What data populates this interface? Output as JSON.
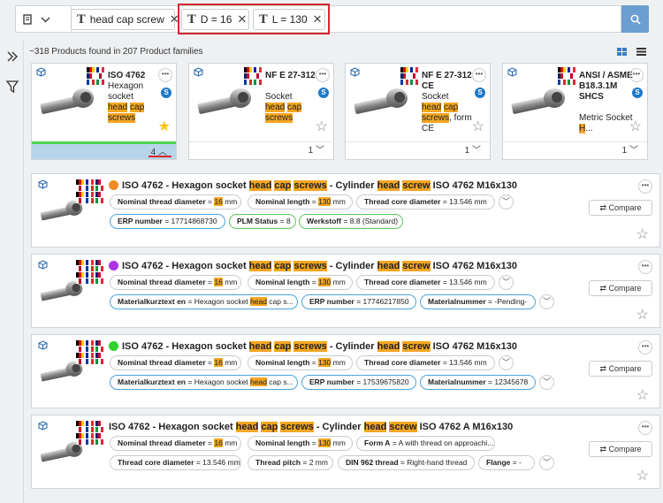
{
  "search": {
    "chips": [
      {
        "label": "head cap screw"
      },
      {
        "label": "D = 16"
      },
      {
        "label": "L = 130"
      }
    ]
  },
  "result_count": "~318 Products found in 207 Product families",
  "cards": [
    {
      "title": "ISO 4762",
      "desc_pre": "Hexagon socket",
      "hl1": "head",
      "hl2": "cap",
      "hl3": "screws",
      "desc_post": "",
      "count": "4",
      "selected": true
    },
    {
      "title": "NF E 27-312",
      "desc_pre": "Socket",
      "hl1": "head",
      "hl2": "cap",
      "hl3": "screws",
      "desc_post": "",
      "count": "1",
      "selected": false
    },
    {
      "title": "NF E 27-312 CE",
      "desc_pre": "Socket",
      "hl1": "head",
      "hl2": "cap",
      "hl3": "screws",
      "desc_post": ", form CE",
      "count": "1",
      "selected": false
    },
    {
      "title": "ANSI / ASME B18.3.1M SHCS",
      "desc_pre": "Metric Socket",
      "hl1": "H",
      "hl2": "",
      "hl3": "",
      "desc_post": "...",
      "count": "1",
      "selected": false
    }
  ],
  "rows": [
    {
      "title_parts": [
        "ISO 4762 - Hexagon socket ",
        "head",
        " ",
        "cap",
        " ",
        "screws",
        " - Cylinder ",
        "head",
        " ",
        "screw",
        " ISO 4762 M16x130"
      ],
      "dot_color": "#f08a24",
      "pills1": [
        {
          "label": "Nominal thread diameter",
          "pre": "= ",
          "hl": "16",
          "post": " mm"
        },
        {
          "label": "Nominal length",
          "pre": "= ",
          "hl": "130",
          "post": " mm"
        },
        {
          "label": "Thread core diameter",
          "pre": "= 13.546 mm",
          "hl": "",
          "post": ""
        }
      ],
      "pills2": [
        {
          "label": "ERP number",
          "pre": "= 17714868730",
          "hl": "",
          "post": "",
          "style": "blue"
        },
        {
          "label": "PLM Status",
          "pre": "= 8",
          "hl": "",
          "post": "",
          "style": "green"
        },
        {
          "label": "Werkstoff",
          "pre": "= 8.8 (Standard)",
          "hl": "",
          "post": "",
          "style": "green"
        }
      ],
      "compare": "Compare"
    },
    {
      "title_parts": [
        "ISO 4762 - Hexagon socket ",
        "head",
        " ",
        "cap",
        " ",
        "screws",
        " - Cylinder ",
        "head",
        " ",
        "screw",
        " ISO 4762 M16x130"
      ],
      "dot_color": "#b033e6",
      "pills1": [
        {
          "label": "Nominal thread diameter",
          "pre": "= ",
          "hl": "16",
          "post": " mm"
        },
        {
          "label": "Nominal length",
          "pre": "= ",
          "hl": "130",
          "post": " mm"
        },
        {
          "label": "Thread core diameter",
          "pre": "= 13.546 mm",
          "hl": "",
          "post": ""
        }
      ],
      "pills2": [
        {
          "label": "Materialkurztext en",
          "pre": "= Hexagon socket ",
          "hl": "head",
          "post": " cap s...",
          "style": "blue"
        },
        {
          "label": "ERP number",
          "pre": "= 17746217850",
          "hl": "",
          "post": "",
          "style": "blue"
        },
        {
          "label": "Materialnummer",
          "pre": "= -Pending-",
          "hl": "",
          "post": "",
          "style": "blue"
        }
      ],
      "compare": "Compare"
    },
    {
      "title_parts": [
        "ISO 4762 - Hexagon socket ",
        "head",
        " ",
        "cap",
        " ",
        "screws",
        " - Cylinder ",
        "head",
        " ",
        "screw",
        " ISO 4762 M16x130"
      ],
      "dot_color": "#2fd12f",
      "pills1": [
        {
          "label": "Nominal thread diameter",
          "pre": "= ",
          "hl": "16",
          "post": " mm"
        },
        {
          "label": "Nominal length",
          "pre": "= ",
          "hl": "130",
          "post": " mm"
        },
        {
          "label": "Thread core diameter",
          "pre": "= 13.546 mm",
          "hl": "",
          "post": ""
        }
      ],
      "pills2": [
        {
          "label": "Materialkurztext en",
          "pre": "= Hexagon socket ",
          "hl": "head",
          "post": " cap s...",
          "style": "blue"
        },
        {
          "label": "ERP number",
          "pre": "= 17539675820",
          "hl": "",
          "post": "",
          "style": "blue"
        },
        {
          "label": "Materialnummer",
          "pre": "= 12345678",
          "hl": "",
          "post": "",
          "style": "blue"
        }
      ],
      "compare": "Compare"
    },
    {
      "title_parts": [
        "ISO 4762 - Hexagon socket ",
        "head",
        " ",
        "cap",
        " ",
        "screws",
        " - Cylinder ",
        "head",
        " ",
        "screw",
        " ISO 4762 A M16x130"
      ],
      "dot_color": "",
      "pills1": [
        {
          "label": "Nominal thread diameter",
          "pre": "= ",
          "hl": "16",
          "post": " mm"
        },
        {
          "label": "Nominal length",
          "pre": "= ",
          "hl": "130",
          "post": " mm"
        },
        {
          "label": "Form A",
          "pre": "= A with thread on approachi...",
          "hl": "",
          "post": ""
        }
      ],
      "pills2": [
        {
          "label": "Thread core diameter",
          "pre": "= 13.546 mm",
          "hl": "",
          "post": "",
          "style": ""
        },
        {
          "label": "Thread pitch",
          "pre": "= 2 mm",
          "hl": "",
          "post": "",
          "style": ""
        },
        {
          "label": "DIN 962 thread",
          "pre": "= Right-hand thread",
          "hl": "",
          "post": "",
          "style": ""
        },
        {
          "label": "Flange",
          "pre": "= -",
          "hl": "",
          "post": "",
          "style": ""
        }
      ],
      "compare": "Compare"
    }
  ],
  "icons": {
    "search": "magnifier-icon",
    "expand": "double-chevron-right-icon",
    "filter": "funnel-icon",
    "grid": "grid-view-icon",
    "list": "list-view-icon"
  },
  "colors": {
    "highlight": "#f5a623",
    "accent": "#6b9fd1",
    "selected_card": "#4cd34c"
  }
}
